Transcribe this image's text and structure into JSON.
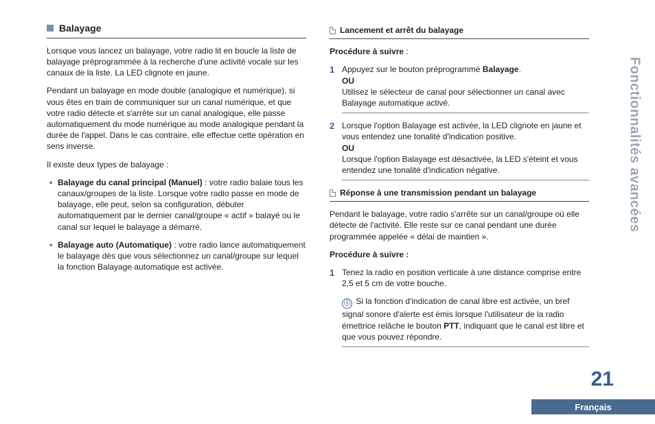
{
  "side_tab": "Fonctionnalités avancées",
  "page_number": "21",
  "language_badge": "Français",
  "left": {
    "heading": "Balayage",
    "p1": "Lorsque vous lancez un balayage, votre radio lit en boucle la liste de balayage préprogrammée à la recherche d'une activité vocale sur les canaux de la liste. La LED clignote en jaune.",
    "p2": "Pendant un balayage en mode double (analogique et numérique), si vous êtes en train de communiquer sur un canal numérique, et que votre radio détecte et s'arrête sur un canal analogique, elle passe automatiquement du mode numérique au mode analogique pendant la durée de l'appel. Dans le cas contraire, elle effectue cette opération en sens inverse.",
    "p3": "Il existe deux types de balayage :",
    "b1_label": "Balayage du canal principal (Manuel)",
    "b1_text": " : votre radio balaie tous les canaux/groupes de la liste. Lorsque votre radio passe en mode de balayage, elle peut, selon sa configuration, débuter automatiquement par le dernier canal/groupe « actif » balayé ou le canal sur lequel le balayage a démarré.",
    "b2_label": "Balayage auto (Automatique)",
    "b2_text": " : votre radio lance automatiquement le balayage dès que vous sélectionnez un canal/groupe sur lequel la fonction Balayage automatique est activée."
  },
  "right": {
    "sub1_title": "Lancement et arrêt du balayage",
    "proc_label1": "Procédure à suivre",
    "proc_colon": " :",
    "s1a": "Appuyez sur le bouton préprogrammé ",
    "s1a_bold": "Balayage",
    "s1a_end": ".",
    "s1_ou": "OU",
    "s1b": "Utilisez le sélecteur de canal pour sélectionner un canal avec Balayage automatique activé.",
    "s2a": "Lorsque l'option Balayage est activée, la LED clignote en jaune et vous entendez une tonalité d'indication positive.",
    "s2_ou": "OU",
    "s2b": "Lorsque l'option Balayage est désactivée, la LED s'éteint et vous entendez une tonalité d'indication négative.",
    "sub2_title": "Réponse à une transmission pendant un balayage",
    "sub2_intro": "Pendant le balayage, votre radio s'arrête sur un canal/groupe où elle détecte de l'activité. Elle reste sur ce canal pendant une durée programmée appelée « délai de maintien ».",
    "proc_label2": "Procédure à suivre :",
    "s3": "Tenez la radio en position verticale à une distance comprise entre 2,5 et 5 cm de votre bouche.",
    "info_glyph": "ⓘ",
    "info_a": " Si la fonction d'indication de canal libre est activée, un bref signal sonore d'alerte est émis lorsque l'utilisateur de la radio émettrice relâche le bouton ",
    "info_bold": "PTT",
    "info_b": ", indiquant que le canal est libre et que vous pouvez répondre."
  }
}
